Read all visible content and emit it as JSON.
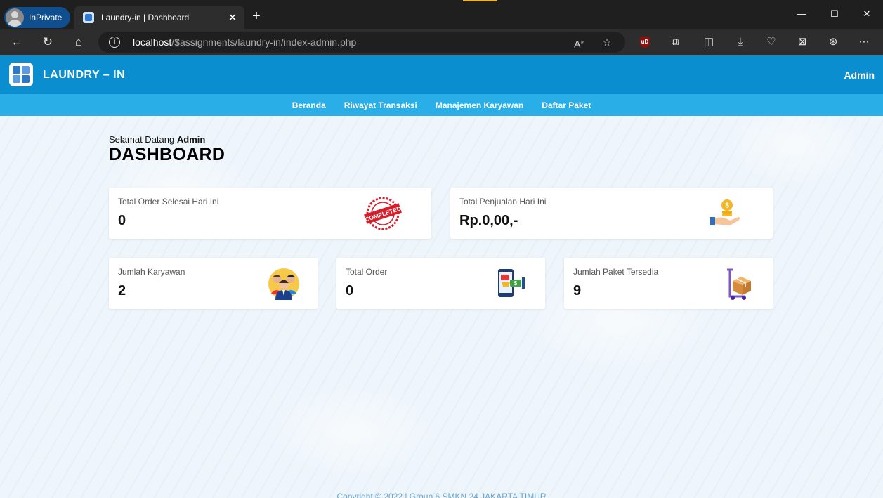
{
  "browser": {
    "inprivate_label": "InPrivate",
    "tab_title": "Laundry-in | Dashboard",
    "url_host": "localhost",
    "url_path": "/$assignments/laundry-in/index-admin.php"
  },
  "header": {
    "brand": "LAUNDRY – IN",
    "user": "Admin"
  },
  "nav": {
    "items": [
      {
        "label": "Beranda"
      },
      {
        "label": "Riwayat Transaksi"
      },
      {
        "label": "Manajemen Karyawan"
      },
      {
        "label": "Daftar Paket"
      }
    ]
  },
  "main": {
    "greeting_prefix": "Selamat Datang",
    "greeting_name": "Admin",
    "title": "DASHBOARD",
    "cards": [
      {
        "label": "Total Order Selesai Hari Ini",
        "value": "0",
        "icon": "completed-stamp-icon"
      },
      {
        "label": "Total Penjualan Hari Ini",
        "value": "Rp.0,00,-",
        "icon": "money-hand-icon"
      },
      {
        "label": "Jumlah Karyawan",
        "value": "2",
        "icon": "employees-icon"
      },
      {
        "label": "Total Order",
        "value": "0",
        "icon": "mobile-shopping-icon"
      },
      {
        "label": "Jumlah Paket Tersedia",
        "value": "9",
        "icon": "package-trolley-icon"
      }
    ],
    "stamp_text": "COMPLETED"
  },
  "footer": {
    "copyright": "Copyright © 2022 | Group 6 SMKN 24 JAKARTA TIMUR"
  },
  "colors": {
    "header": "#0b8ed0",
    "subnav": "#2aaee8",
    "background": "#eef5fb"
  }
}
